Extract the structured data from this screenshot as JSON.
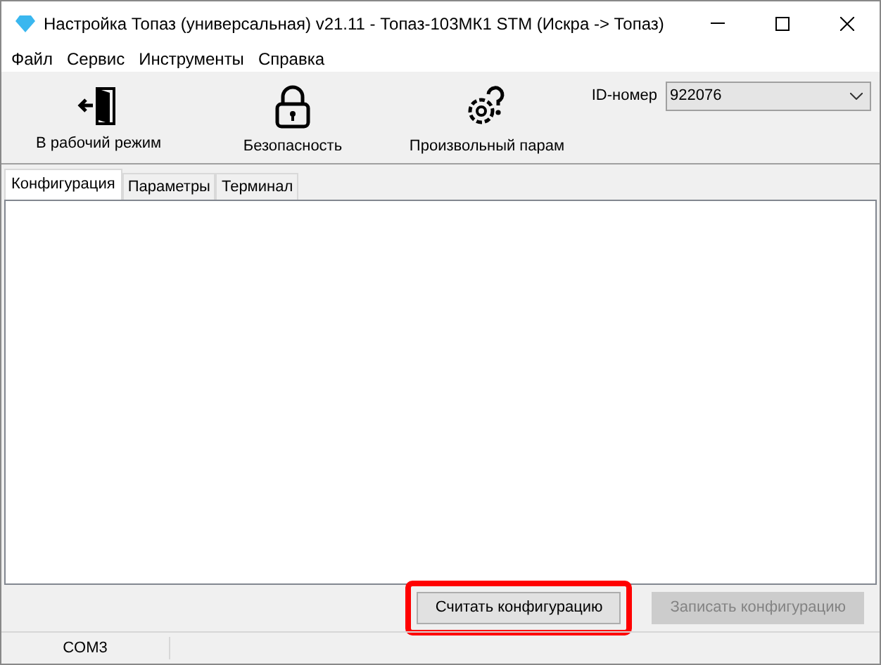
{
  "window": {
    "title": "Настройка Топаз (универсальная) v21.11 - Топаз-103МК1 STM (Искра -> Топаз)"
  },
  "menu": [
    "Файл",
    "Сервис",
    "Инструменты",
    "Справка"
  ],
  "toolbar": [
    {
      "kind": "exit",
      "label": "В рабочий режим"
    },
    {
      "kind": "lock",
      "label": "Безопасность"
    },
    {
      "kind": "gear",
      "label": "Произвольный парам"
    }
  ],
  "id_field": {
    "label": "ID-номер",
    "value": "922076"
  },
  "tabs": [
    {
      "label": "Конфигурация",
      "selected": true
    },
    {
      "label": "Параметры",
      "selected": false
    },
    {
      "label": "Терминал",
      "selected": false
    }
  ],
  "buttons": [
    {
      "label": "Считать конфигурацию",
      "disabled": false,
      "highlighted": true
    },
    {
      "label": "Записать конфигурацию",
      "disabled": true,
      "highlighted": false
    }
  ],
  "status_bar": {
    "port": "COM3"
  }
}
